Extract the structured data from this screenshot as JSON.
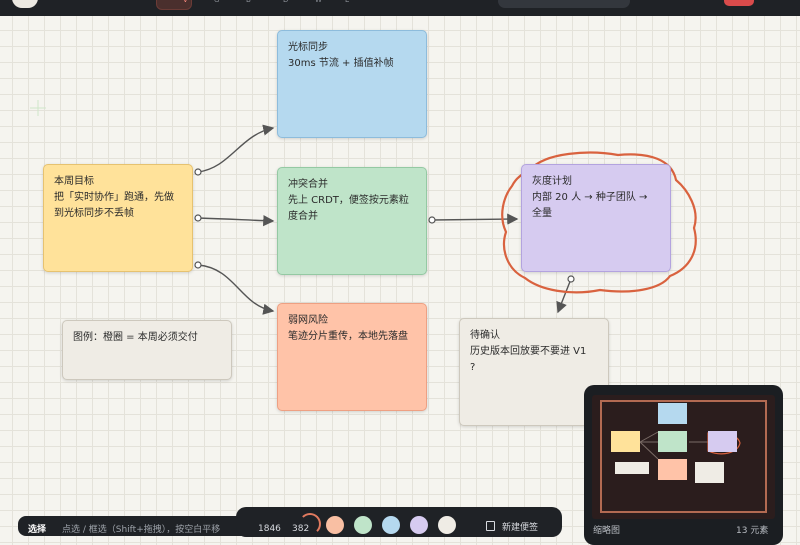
{
  "toolbar": {
    "active_key": "V",
    "keys": [
      "G",
      "B",
      "D",
      "W",
      "E"
    ]
  },
  "canvas": {
    "notes": {
      "goal": {
        "lines": [
          "本周目标",
          "把「实时协作」跑通，先做",
          "到光标同步不丢帧"
        ]
      },
      "cursor": {
        "lines": [
          "光标同步",
          "30ms 节流 + 插值补帧"
        ]
      },
      "merge": {
        "lines": [
          "冲突合并",
          "先上 CRDT，便签按元素粒",
          "度合并"
        ]
      },
      "weak": {
        "lines": [
          "弱网风险",
          "笔迹分片重传，本地先落盘"
        ]
      },
      "gray": {
        "lines": [
          "灰度计划",
          "内部 20 人 → 种子团队 →",
          "全量"
        ]
      },
      "pending": {
        "lines": [
          "待确认",
          "历史版本回放要不要进 V1",
          "?"
        ]
      },
      "legend": {
        "lines": [
          "图例：橙圈 = 本周必须交付"
        ]
      }
    }
  },
  "status": {
    "mode": "选择",
    "hint": "点选 / 框选（Shift+拖拽），按空白平移",
    "coord_x": "1846",
    "coord_y": "382"
  },
  "palette": {
    "colors": [
      "#f9bfa3",
      "#bfe4c9",
      "#b5d9ef",
      "#d6cbf0",
      "#efece5"
    ],
    "new_note": "新建便签"
  },
  "minimap": {
    "label": "缩略图",
    "count": "13 元素"
  },
  "theme": {
    "accent": "#e07a5f",
    "highlight_ring": "#d9623f"
  }
}
